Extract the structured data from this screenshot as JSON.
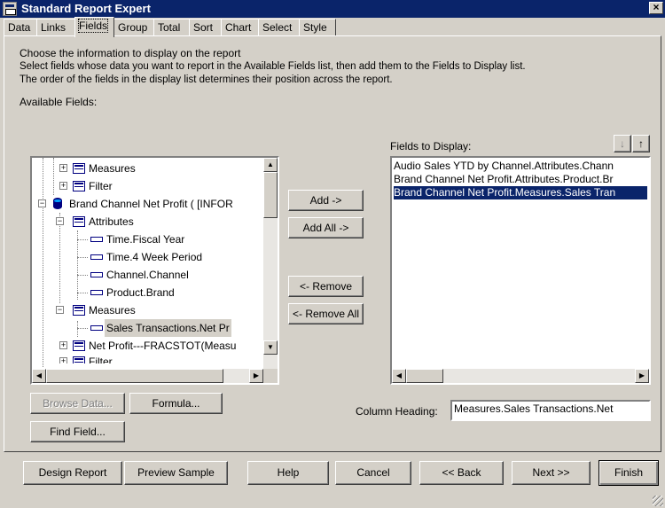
{
  "window": {
    "title": "Standard Report Expert",
    "close": "×"
  },
  "tabs": [
    {
      "label": "Data"
    },
    {
      "label": "Links"
    },
    {
      "label": "Fields"
    },
    {
      "label": "Group"
    },
    {
      "label": "Total"
    },
    {
      "label": "Sort"
    },
    {
      "label": "Chart"
    },
    {
      "label": "Select"
    },
    {
      "label": "Style"
    }
  ],
  "instructions": {
    "line1": "Choose the information to display on the report",
    "line2": "Select fields whose data you want to report in the Available Fields list, then add them to the Fields to Display list.",
    "line3": "The order of the fields in the display list determines their position across the report."
  },
  "available": {
    "label": "Available Fields:",
    "items": [
      {
        "label": "Measures"
      },
      {
        "label": "Filter"
      },
      {
        "label": "Brand Channel Net Profit ( [INFOR"
      },
      {
        "label": "Attributes"
      },
      {
        "label": "Time.Fiscal Year"
      },
      {
        "label": "Time.4 Week Period"
      },
      {
        "label": "Channel.Channel"
      },
      {
        "label": "Product.Brand"
      },
      {
        "label": "Measures"
      },
      {
        "label": "Sales Transactions.Net Pr"
      },
      {
        "label": "Net Profit---FRACSTOT(Measu"
      },
      {
        "label": "Filter"
      }
    ]
  },
  "display": {
    "label": "Fields to Display:",
    "items": [
      {
        "label": "Audio Sales YTD by Channel.Attributes.Chann"
      },
      {
        "label": "Brand Channel Net Profit.Attributes.Product.Br"
      },
      {
        "label": "Brand Channel Net Profit.Measures.Sales Tran"
      }
    ],
    "move_down": "↓",
    "move_up": "↑"
  },
  "buttons": {
    "add": "Add ->",
    "add_all": "Add All ->",
    "remove": "<- Remove",
    "remove_all": "<- Remove All",
    "browse": "Browse Data...",
    "formula": "Formula...",
    "find": "Find Field...",
    "design": "Design Report",
    "preview": "Preview Sample",
    "help": "Help",
    "cancel": "Cancel",
    "back": "<< Back",
    "next": "Next >>",
    "finish": "Finish"
  },
  "column_heading": {
    "label": "Column Heading:",
    "value": "Measures.Sales Transactions.Net"
  }
}
